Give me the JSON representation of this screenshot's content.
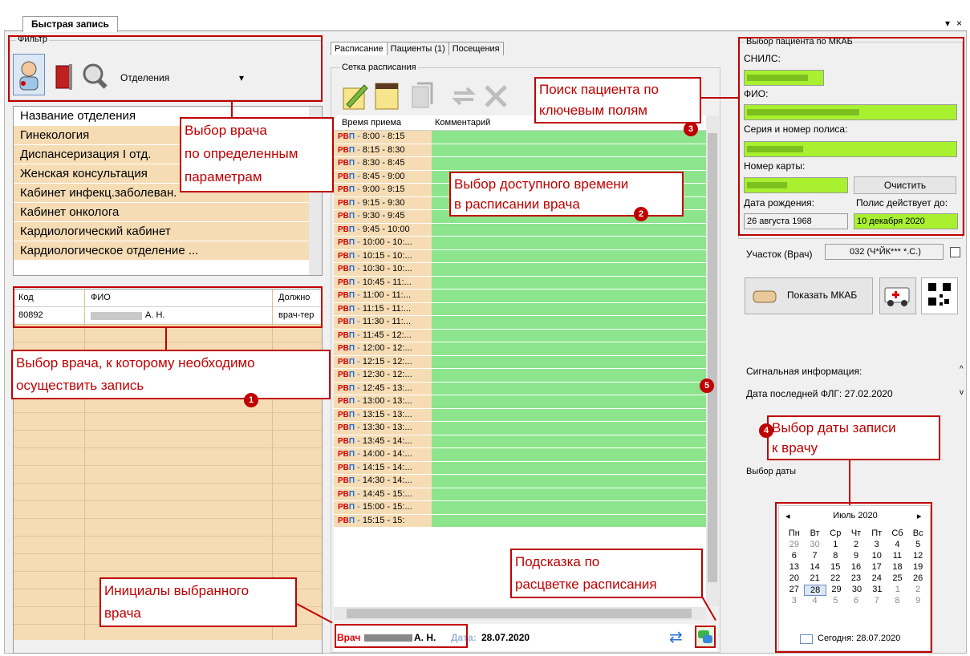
{
  "window": {
    "title": "Быстрая запись",
    "pin": "▾",
    "close": "×"
  },
  "filter": {
    "title": "Фильтр",
    "dropdown_value": "Отделения"
  },
  "departments": {
    "header": "Название отделения",
    "items": [
      "Гинекология",
      "Диспансеризация I отд.",
      "Женская консультация",
      "Кабинет инфекц.заболеван.",
      "Кабинет онколога",
      "Кардиологический кабинет",
      "Кардиологическое отделение ..."
    ]
  },
  "doctors": {
    "headers": [
      "Код",
      "ФИО",
      "Должно"
    ],
    "rows": [
      {
        "code": "80892",
        "fio": "А. Н.",
        "position": "врач-тер"
      }
    ]
  },
  "tabs": [
    "Расписание",
    "Пациенты (1)",
    "Посещения"
  ],
  "schedule": {
    "group_title": "Сетка расписания",
    "col_time": "Время приема",
    "col_comment": "Комментарий",
    "prefix_a": "РВ",
    "prefix_b": "П",
    "rows": [
      "8:00 - 8:15",
      "8:15 - 8:30",
      "8:30 - 8:45",
      "8:45 - 9:00",
      "9:00 - 9:15",
      "9:15 - 9:30",
      "9:30 - 9:45",
      "9:45 - 10:00",
      "10:00 - 10:...",
      "10:15 - 10:...",
      "10:30 - 10:...",
      "10:45 - 11:...",
      "11:00 - 11:...",
      "11:15 - 11:...",
      "11:30 - 11:...",
      "11:45 - 12:...",
      "12:00 - 12:...",
      "12:15 - 12:...",
      "12:30 - 12:...",
      "12:45 - 13:...",
      "13:00 - 13:...",
      "13:15 - 13:...",
      "13:30 - 13:...",
      "13:45 - 14:...",
      "14:00 - 14:...",
      "14:15 - 14:...",
      "14:30 - 14:...",
      "14:45 - 15:...",
      "15:00 - 15:...",
      "15:15 - 15:"
    ]
  },
  "footer": {
    "doctor_label": "Врач",
    "doctor_name": "А. Н.",
    "date_label": "Дата:",
    "date_value": "28.07.2020"
  },
  "patient": {
    "title": "Выбор пациента по МКАБ",
    "snils_label": "СНИЛС:",
    "fio_label": "ФИО:",
    "policy_label": "Серия и номер полиса:",
    "card_label": "Номер карты:",
    "clear_button": "Очистить",
    "birth_label": "Дата рождения:",
    "birth_value": "26 августа 1968",
    "policy_valid_label": "Полис действует до:",
    "policy_valid_value": "10 декабря 2020",
    "district_label": "Участок (Врач)",
    "district_value": "032 (Ч*ЙК*** *.С.)",
    "show_mkab": "Показать МКАБ",
    "signal_title": "Сигнальная информация:",
    "signal_text": "Дата последней ФЛГ: 27.02.2020",
    "date_title": "Выбор даты"
  },
  "calendar": {
    "month": "Июль 2020",
    "weekdays": [
      "Пн",
      "Вт",
      "Ср",
      "Чт",
      "Пт",
      "Сб",
      "Вс"
    ],
    "weeks": [
      [
        "29",
        "30",
        "1",
        "2",
        "3",
        "4",
        "5"
      ],
      [
        "6",
        "7",
        "8",
        "9",
        "10",
        "11",
        "12"
      ],
      [
        "13",
        "14",
        "15",
        "16",
        "17",
        "18",
        "19"
      ],
      [
        "20",
        "21",
        "22",
        "23",
        "24",
        "25",
        "26"
      ],
      [
        "27",
        "28",
        "29",
        "30",
        "31",
        "1",
        "2"
      ],
      [
        "3",
        "4",
        "5",
        "6",
        "7",
        "8",
        "9"
      ]
    ],
    "selected": "28",
    "today": "Сегодня: 28.07.2020"
  },
  "callouts": {
    "c_doctor_params": [
      "Выбор врача",
      "по определенным",
      "параметрам"
    ],
    "c_doctor_select": [
      "Выбор врача, к которому необходимо",
      "осуществить запись"
    ],
    "c_time": [
      "Выбор доступного времени",
      "в расписании врача"
    ],
    "c_search": [
      "Поиск пациента по",
      "ключевым полям"
    ],
    "c_date": [
      "Выбор даты записи",
      "к врачу"
    ],
    "c_hint": [
      "Подсказка по",
      "расцветке расписания"
    ],
    "c_initials": [
      "Инициалы выбранного",
      "врача"
    ],
    "badges": [
      "1",
      "2",
      "3",
      "4",
      "5"
    ]
  }
}
